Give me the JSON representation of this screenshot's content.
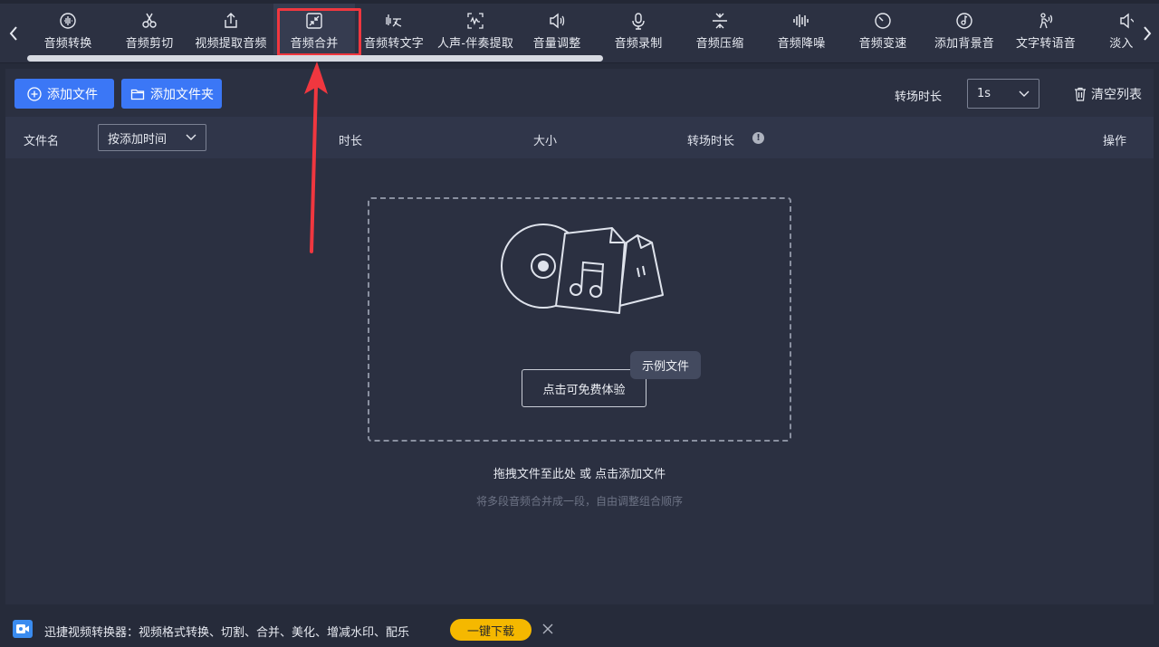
{
  "toolbar": {
    "tools": [
      {
        "label": "音频转换",
        "icon": "audio-wave-icon"
      },
      {
        "label": "音频剪切",
        "icon": "scissors-icon"
      },
      {
        "label": "视频提取音频",
        "icon": "upload-icon"
      },
      {
        "label": "音频合并",
        "icon": "merge-icon",
        "active": true
      },
      {
        "label": "音频转文字",
        "icon": "speech-to-text-icon"
      },
      {
        "label": "人声-伴奏提取",
        "icon": "vocal-extract-icon"
      },
      {
        "label": "音量调整",
        "icon": "speaker-icon"
      },
      {
        "label": "音频录制",
        "icon": "microphone-icon"
      },
      {
        "label": "音频压缩",
        "icon": "compress-icon"
      },
      {
        "label": "音频降噪",
        "icon": "noise-reduction-icon"
      },
      {
        "label": "音频变速",
        "icon": "speed-dial-icon"
      },
      {
        "label": "添加背景音",
        "icon": "music-note-icon"
      },
      {
        "label": "文字转语音",
        "icon": "text-to-speech-icon"
      },
      {
        "label": "淡入淡",
        "icon": "fade-icon"
      }
    ]
  },
  "actions": {
    "add_file": "添加文件",
    "add_folder": "添加文件夹",
    "transition_label": "转场时长",
    "transition_value": "1s",
    "clear_list": "清空列表"
  },
  "table": {
    "col_filename": "文件名",
    "sort_value": "按添加时间",
    "col_duration": "时长",
    "col_size": "大小",
    "col_transition": "转场时长",
    "col_actions": "操作"
  },
  "dropzone": {
    "try_button": "点击可免费体验",
    "sample_tag": "示例文件",
    "hint_primary": "拖拽文件至此处 或 点击添加文件",
    "hint_secondary": "将多段音频合并成一段，自由调整组合顺序"
  },
  "adbar": {
    "text": "迅捷视频转换器：视频格式转换、切割、合并、美化、增减水印、配乐",
    "button": "一键下载"
  },
  "colors": {
    "accent": "#3b77f6",
    "highlight": "#f0373f",
    "ad_button": "#f5b800"
  }
}
